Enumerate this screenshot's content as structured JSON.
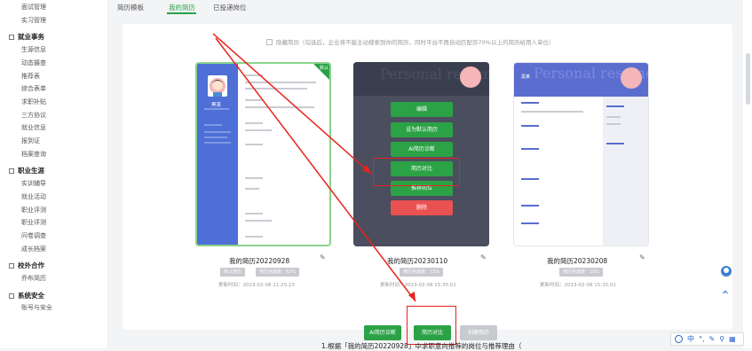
{
  "sidebar": {
    "items": [
      {
        "label": "面试管理",
        "type": "item"
      },
      {
        "label": "实习管理",
        "type": "item"
      },
      {
        "label": "就业事务",
        "type": "section"
      },
      {
        "label": "生源信息",
        "type": "item"
      },
      {
        "label": "动态摄查",
        "type": "item"
      },
      {
        "label": "推荐表",
        "type": "item"
      },
      {
        "label": "综合表单",
        "type": "item"
      },
      {
        "label": "求职补贴",
        "type": "item"
      },
      {
        "label": "三方协议",
        "type": "item"
      },
      {
        "label": "就业信息",
        "type": "item"
      },
      {
        "label": "报到证",
        "type": "item"
      },
      {
        "label": "档案查询",
        "type": "item"
      },
      {
        "label": "职业生涯",
        "type": "section"
      },
      {
        "label": "实训辅导",
        "type": "item"
      },
      {
        "label": "就业活动",
        "type": "item"
      },
      {
        "label": "职业评测",
        "type": "item"
      },
      {
        "label": "职业评测",
        "type": "item"
      },
      {
        "label": "问卷调查",
        "type": "item"
      },
      {
        "label": "成长档案",
        "type": "item"
      },
      {
        "label": "校外合作",
        "type": "section"
      },
      {
        "label": "乔布简历",
        "type": "item"
      },
      {
        "label": "系统安全",
        "type": "section"
      },
      {
        "label": "账号与安全",
        "type": "item"
      }
    ]
  },
  "tabs": [
    "简历模板",
    "我的简历",
    "已投递岗位"
  ],
  "active_tab": "我的简历",
  "notice": "隐藏简历（勾选后，企业将不能主动搜索到你的简历，同时平台不再自动匹配亦70%以上的简历给用人单位）",
  "cards": [
    {
      "name": "我的简历20220928",
      "badge1": "默认简历",
      "badge2": "简历完成度：62%",
      "time": "更新时间：2023-02-08 11:25:23",
      "ribbon": "默认",
      "thumb_title": "",
      "thumb_name": "黑某"
    },
    {
      "name": "我的简历20230110",
      "badge1": "",
      "badge2": "简历完成度：33%",
      "time": "更新时间：2023-02-08 15:35:01",
      "thumb_title": "Personal resume"
    },
    {
      "name": "我的简历20230208",
      "badge1": "",
      "badge2": "简历完成度：10%",
      "time": "更新时间：2023-02-08 15:35:01",
      "thumb_title": "Personal resume",
      "thumb_name": "黑某"
    }
  ],
  "overlay_menu": [
    "编辑",
    "设为默认简历",
    "AI简历诊断",
    "简历对比",
    "推荐岗位",
    "删除"
  ],
  "actions": [
    "AI简历诊断",
    "简历对比",
    "创建简历"
  ],
  "bottom_text": "1.根据「我的简历20220928」中求职意向推荐的岗位与推荐理由（",
  "ime": [
    "中",
    "°,",
    "✎",
    "⚲",
    "▦"
  ],
  "colors": {
    "accent": "#2ba246",
    "danger": "#ea5151",
    "annotation": "#e8231c",
    "card1": "#4e6fd6",
    "card2": "#3a3f4f"
  }
}
